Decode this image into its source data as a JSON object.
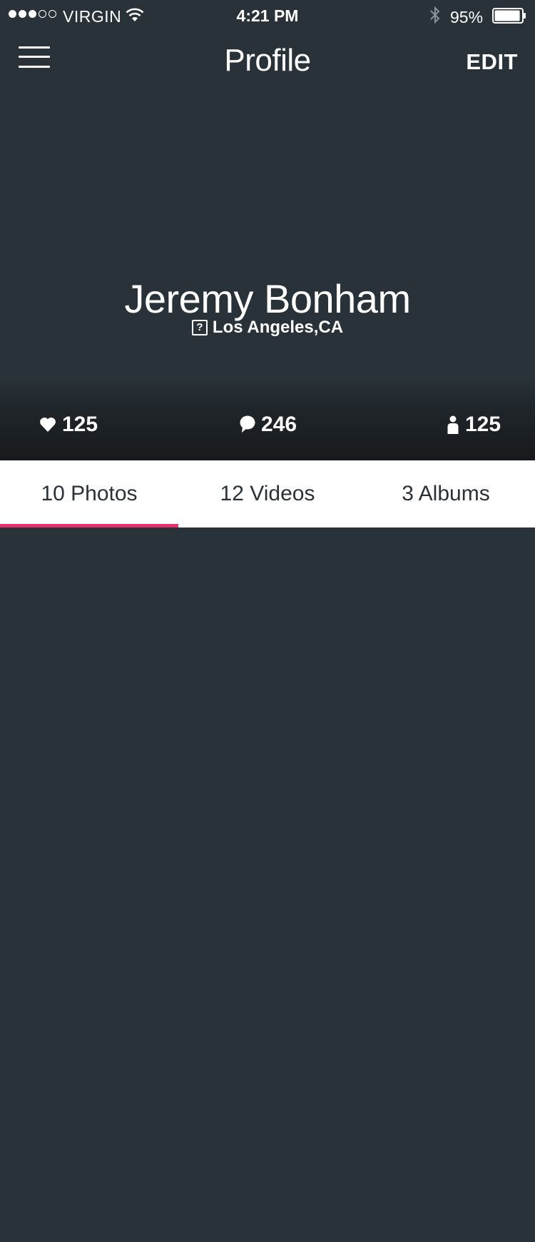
{
  "status_bar": {
    "carrier": "VIRGIN",
    "time": "4:21 PM",
    "battery_percent": "95%",
    "signal_bars_filled": 3,
    "signal_bars_total": 5,
    "battery_level": 0.95
  },
  "nav": {
    "title": "Profile",
    "edit_label": "EDIT"
  },
  "profile": {
    "name": "Jeremy Bonham",
    "location": "Los Angeles,CA",
    "location_icon_glyph": "?"
  },
  "stats": {
    "likes": "125",
    "comments": "246",
    "followers": "125"
  },
  "tabs": [
    {
      "label": "10 Photos",
      "active": true
    },
    {
      "label": "12 Videos",
      "active": false
    },
    {
      "label": "3 Albums",
      "active": false
    }
  ],
  "colors": {
    "background": "#283238",
    "accent": "#e8306a",
    "tab_bar": "#ffffff",
    "tab_text": "#283238"
  },
  "icons": {
    "menu": "hamburger-icon",
    "wifi": "wifi-icon",
    "bluetooth": "bluetooth-icon",
    "battery": "battery-icon",
    "location": "location-question-icon",
    "likes": "heart-icon",
    "comments": "speech-bubble-icon",
    "followers": "person-icon"
  }
}
